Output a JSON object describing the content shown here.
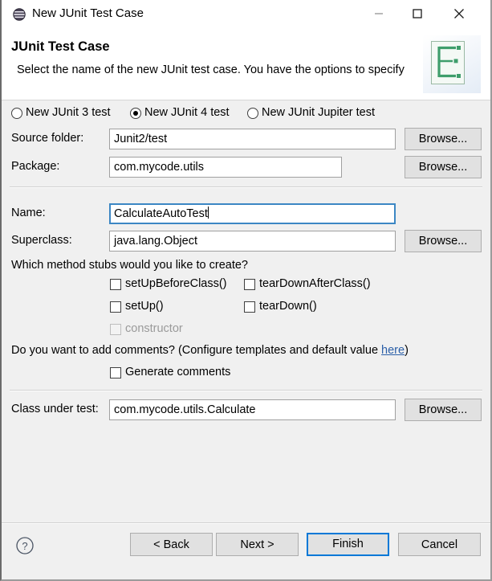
{
  "window": {
    "title": "New JUnit Test Case",
    "icon": "junit-sphere-icon",
    "minimize_label": "Minimize",
    "maximize_label": "Maximize",
    "close_label": "Close"
  },
  "header": {
    "title": "JUnit Test Case",
    "description": "Select the name of the new JUnit test case. You have the options to specify",
    "banner_icon": "junit-wizard-banner-icon"
  },
  "test_kind": {
    "options": [
      {
        "label": "New JUnit 3 test",
        "selected": false
      },
      {
        "label": "New JUnit 4 test",
        "selected": true
      },
      {
        "label": "New JUnit Jupiter test",
        "selected": false
      }
    ]
  },
  "fields": {
    "source_folder": {
      "label": "Source folder:",
      "value": "Junit2/test",
      "browse_label": "Browse...",
      "focused": false
    },
    "package": {
      "label": "Package:",
      "value": "com.mycode.utils",
      "browse_label": "Browse...",
      "focused": false
    },
    "name": {
      "label": "Name:",
      "value": "CalculateAutoTest",
      "focused": true
    },
    "superclass": {
      "label": "Superclass:",
      "value": "java.lang.Object",
      "browse_label": "Browse...",
      "focused": false
    },
    "class_under_test": {
      "label": "Class under test:",
      "value": "com.mycode.utils.Calculate",
      "browse_label": "Browse...",
      "focused": false
    }
  },
  "method_stubs": {
    "question": "Which method stubs would you like to create?",
    "items": [
      {
        "label": "setUpBeforeClass()",
        "checked": false,
        "disabled": false
      },
      {
        "label": "tearDownAfterClass()",
        "checked": false,
        "disabled": false
      },
      {
        "label": "setUp()",
        "checked": false,
        "disabled": false
      },
      {
        "label": "tearDown()",
        "checked": false,
        "disabled": false
      },
      {
        "label": "constructor",
        "checked": false,
        "disabled": true
      }
    ]
  },
  "comments": {
    "question_before_link": "Do you want to add comments? (Configure templates and default value ",
    "link_label": "here",
    "question_after_link": ")",
    "checkbox_label": "Generate comments",
    "checked": false
  },
  "footer": {
    "help_label": "?",
    "back_label": "< Back",
    "next_label": "Next >",
    "finish_label": "Finish",
    "cancel_label": "Cancel",
    "default_button": "Finish"
  },
  "colors": {
    "dialog_background": "#f0f0f0",
    "banner_background": "#ffffff",
    "focus_border": "#3c87c4",
    "default_button_border": "#0078d7",
    "link": "#2b5fa8",
    "disabled_text": "#9a9a9a",
    "banner_glyph_green": "#3f9e6c"
  }
}
